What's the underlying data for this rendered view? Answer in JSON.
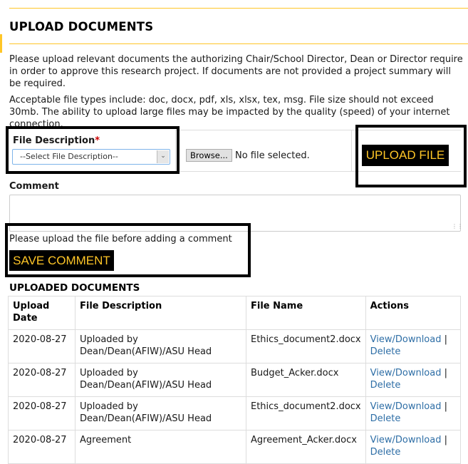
{
  "page": {
    "title": "UPLOAD DOCUMENTS",
    "intro": "Please upload relevant documents the authorizing Chair/School Director, Dean or Director require in order to approve this research project. If documents are not provided a project summary will be required.",
    "file_types_note": "Acceptable file types include: doc, docx, pdf, xls, xlsx, tex, msg. File size should not exceed 30mb. The ability to upload large files may be impacted by the quality (speed) of your internet connection.",
    "accent_color": "#ffc627"
  },
  "upload_form": {
    "file_description_label": "File Description",
    "required_marker": "*",
    "select_value": "--Select File Description--",
    "browse_label": "Browse...",
    "file_status": "No file selected.",
    "upload_button": "UPLOAD FILE",
    "comment_label": "Comment",
    "comment_value": "",
    "comment_hint": "Please upload the file before adding a comment",
    "save_comment_button": "SAVE COMMENT"
  },
  "uploaded_documents": {
    "title": "UPLOADED DOCUMENTS",
    "columns": [
      "Upload Date",
      "File Description",
      "File Name",
      "Actions"
    ],
    "rows": [
      {
        "date": "2020-08-27",
        "description": "Uploaded by Dean/Dean(AFIW)/ASU Head",
        "file_name": "Ethics_document2.docx",
        "view_label": "View/Download",
        "separator": "|",
        "delete_label": "Delete"
      },
      {
        "date": "2020-08-27",
        "description": "Uploaded by Dean/Dean(AFIW)/ASU Head",
        "file_name": "Budget_Acker.docx",
        "view_label": "View/Download",
        "separator": "|",
        "delete_label": "Delete"
      },
      {
        "date": "2020-08-27",
        "description": "Uploaded by Dean/Dean(AFIW)/ASU Head",
        "file_name": "Ethics_document2.docx",
        "view_label": "View/Download",
        "separator": "|",
        "delete_label": "Delete"
      },
      {
        "date": "2020-08-27",
        "description": "Agreement",
        "file_name": "Agreement_Acker.docx",
        "view_label": "View/Download",
        "separator": "|",
        "delete_label": "Delete"
      }
    ]
  }
}
